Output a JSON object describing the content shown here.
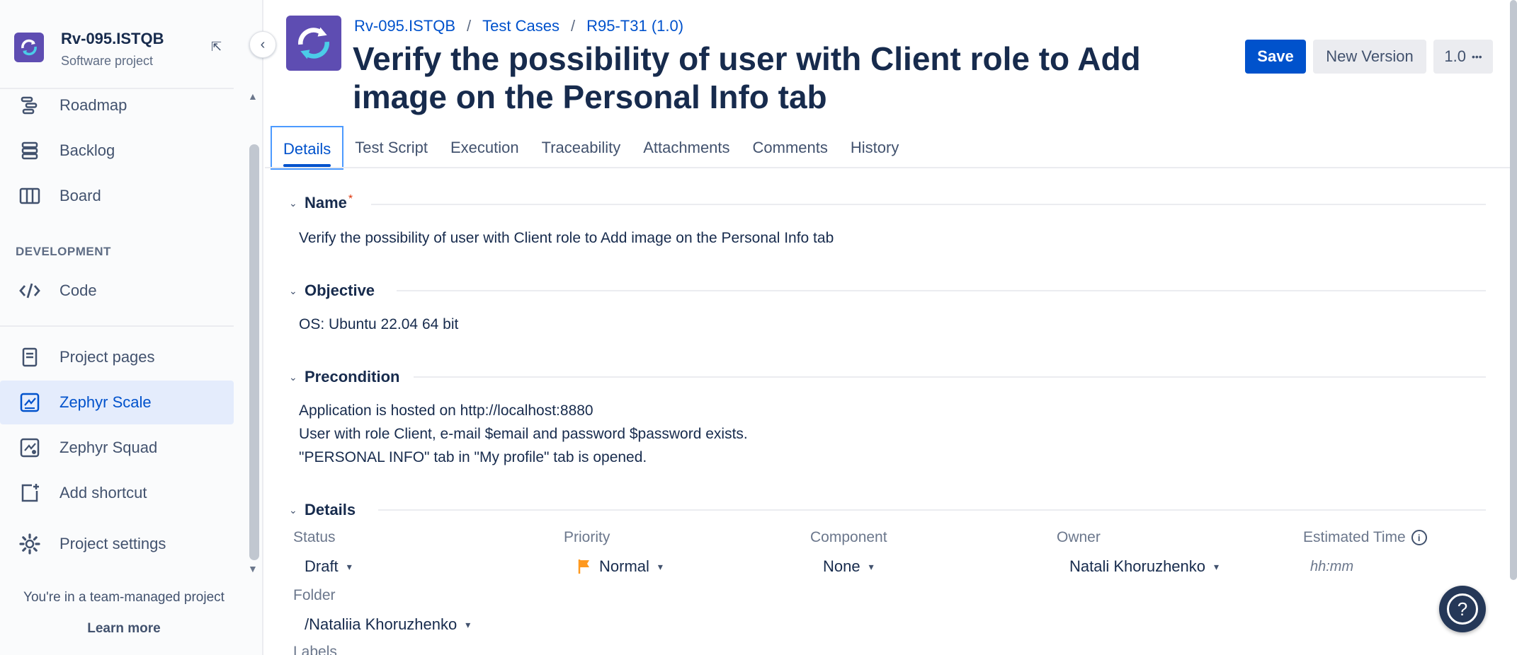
{
  "project": {
    "name": "Rv-095.ISTQB",
    "type": "Software project"
  },
  "sidebar": {
    "items": [
      {
        "label": "Roadmap",
        "icon": "roadmap-icon"
      },
      {
        "label": "Backlog",
        "icon": "backlog-icon"
      },
      {
        "label": "Board",
        "icon": "board-icon"
      },
      {
        "label": "Code",
        "icon": "code-icon"
      },
      {
        "label": "Project pages",
        "icon": "pages-icon"
      },
      {
        "label": "Zephyr Scale",
        "icon": "zephyr-scale-icon",
        "active": true
      },
      {
        "label": "Zephyr Squad",
        "icon": "zephyr-squad-icon"
      },
      {
        "label": "Add shortcut",
        "icon": "add-shortcut-icon"
      },
      {
        "label": "Project settings",
        "icon": "gear-icon"
      }
    ],
    "section_label": "DEVELOPMENT",
    "footer": {
      "text": "You're in a team-managed project",
      "link": "Learn more"
    }
  },
  "breadcrumb": [
    "Rv-095.ISTQB",
    "Test Cases",
    "R95-T31 (1.0)"
  ],
  "title": "Verify the possibility of user with Client role to Add image on the Personal Info tab",
  "actions": {
    "save": "Save",
    "new_version": "New Version",
    "version": "1.0",
    "more": "•••"
  },
  "tabs": [
    "Details",
    "Test Script",
    "Execution",
    "Traceability",
    "Attachments",
    "Comments",
    "History"
  ],
  "sections": {
    "name": {
      "title": "Name",
      "required": "*",
      "value": "Verify the possibility of user with Client role to Add image on the Personal Info tab"
    },
    "objective": {
      "title": "Objective",
      "value": "OS: Ubuntu 22.04 64 bit"
    },
    "precondition": {
      "title": "Precondition",
      "lines": [
        "Application is hosted on http://localhost:8880",
        "User with role Client, e-mail $email and password $password exists.",
        "\"PERSONAL INFO\" tab in \"My profile\" tab is opened."
      ]
    },
    "details": {
      "title": "Details",
      "status": {
        "label": "Status",
        "value": "Draft"
      },
      "priority": {
        "label": "Priority",
        "value": "Normal"
      },
      "component": {
        "label": "Component",
        "value": "None"
      },
      "owner": {
        "label": "Owner",
        "value": "Natali Khoruzhenko"
      },
      "estimated_time": {
        "label": "Estimated Time",
        "placeholder": "hh:mm"
      },
      "folder": {
        "label": "Folder",
        "value": "/Nataliia Khoruzhenko"
      },
      "labels": {
        "label": "Labels"
      }
    }
  },
  "colors": {
    "accent": "#0052cc",
    "active_bg": "#e4ecfc",
    "priority_flag": "#ff991f"
  }
}
